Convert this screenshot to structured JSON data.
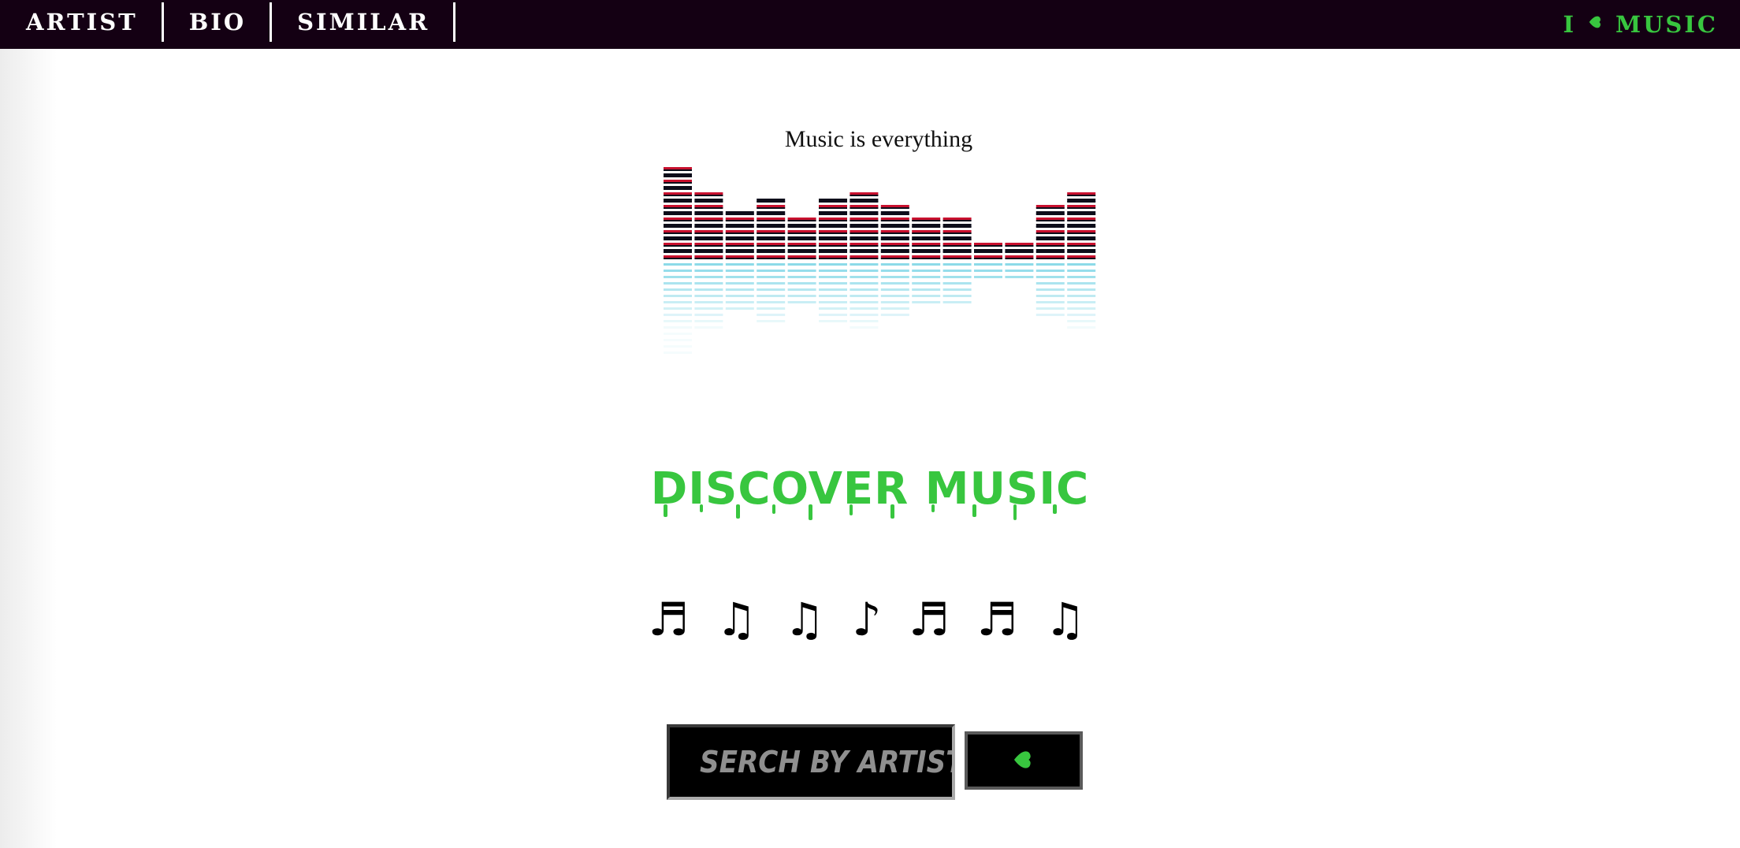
{
  "nav": {
    "links": [
      {
        "label": "ARTIST"
      },
      {
        "label": "BIO"
      },
      {
        "label": "SIMILAR"
      }
    ],
    "brand": {
      "prefix": "I",
      "icon": "heart-icon",
      "suffix": "MUSIC"
    }
  },
  "banner": {
    "caption": "Music is everything",
    "bar_levels": [
      15,
      11,
      8,
      10,
      7,
      10,
      11,
      9,
      7,
      7,
      3,
      3,
      9,
      11
    ]
  },
  "headline": "DISCOVER MUSIC",
  "notes": "♬ ♫ ♫ ♪ ♬ ♬ ♫",
  "search": {
    "placeholder": "SERCH BY ARTIST....",
    "button_icon": "heart-icon"
  },
  "colors": {
    "nav_bg": "#140013",
    "accent_green": "#38c63f",
    "bar_dark": "#0d0d1a",
    "bar_red": "#c8102e",
    "reflection_cyan": "#7fd6e6"
  }
}
